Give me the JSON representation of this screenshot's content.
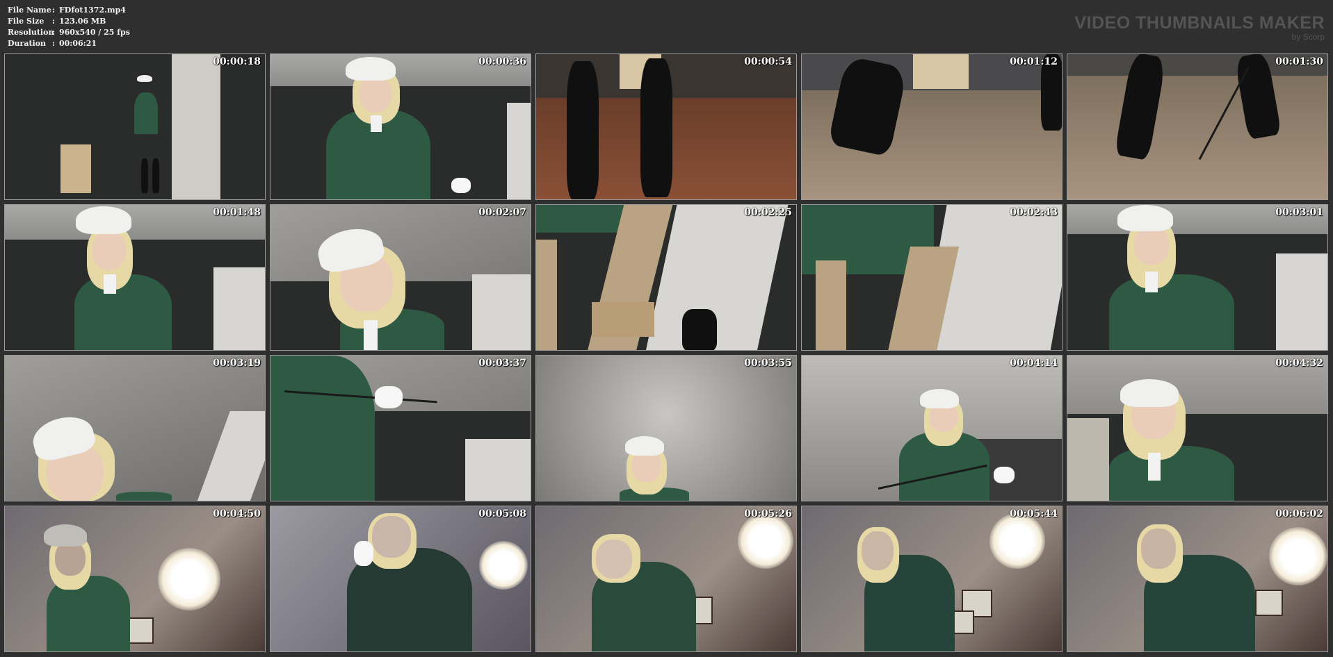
{
  "file_info": {
    "file_name_label": "File Name",
    "file_name_value": "FDfot1372.mp4",
    "file_size_label": "File Size",
    "file_size_value": "123.06 MB",
    "resolution_label": "Resolution",
    "resolution_value": "960x540 / 25 fps",
    "duration_label": "Duration",
    "duration_value": "00:06:21",
    "separator": ":"
  },
  "brand": {
    "title": "VIDEO THUMBNAILS MAKER",
    "subtitle": "by Scorp"
  },
  "thumbnails": [
    {
      "timestamp": "00:00:18"
    },
    {
      "timestamp": "00:00:36"
    },
    {
      "timestamp": "00:00:54"
    },
    {
      "timestamp": "00:01:12"
    },
    {
      "timestamp": "00:01:30"
    },
    {
      "timestamp": "00:01:48"
    },
    {
      "timestamp": "00:02:07"
    },
    {
      "timestamp": "00:02:25"
    },
    {
      "timestamp": "00:02:43"
    },
    {
      "timestamp": "00:03:01"
    },
    {
      "timestamp": "00:03:19"
    },
    {
      "timestamp": "00:03:37"
    },
    {
      "timestamp": "00:03:55"
    },
    {
      "timestamp": "00:04:14"
    },
    {
      "timestamp": "00:04:32"
    },
    {
      "timestamp": "00:04:50"
    },
    {
      "timestamp": "00:05:08"
    },
    {
      "timestamp": "00:05:26"
    },
    {
      "timestamp": "00:05:44"
    },
    {
      "timestamp": "00:06:02"
    }
  ]
}
